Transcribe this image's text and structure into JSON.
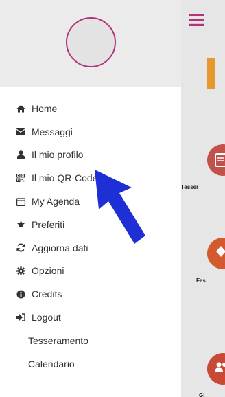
{
  "menu": {
    "items": [
      {
        "label": "Home",
        "icon": "home-icon"
      },
      {
        "label": "Messaggi",
        "icon": "envelope-icon"
      },
      {
        "label": "Il mio profilo",
        "icon": "user-icon"
      },
      {
        "label": "Il mio QR-Code",
        "icon": "qrcode-icon"
      },
      {
        "label": "My Agenda",
        "icon": "calendar-icon"
      },
      {
        "label": "Preferiti",
        "icon": "star-icon"
      },
      {
        "label": "Aggiorna dati",
        "icon": "refresh-icon"
      },
      {
        "label": "Opzioni",
        "icon": "gear-icon"
      },
      {
        "label": "Credits",
        "icon": "info-icon"
      },
      {
        "label": "Logout",
        "icon": "logout-icon"
      },
      {
        "label": "Tesseramento",
        "icon": ""
      },
      {
        "label": "Calendario",
        "icon": ""
      }
    ]
  },
  "background": {
    "tiles": [
      {
        "label": "Tesser"
      },
      {
        "label": "Fes"
      },
      {
        "label": "Gi"
      }
    ]
  },
  "colors": {
    "accent": "#b3337a",
    "orange": "#e4982d",
    "arrow": "#1f2fd6",
    "header_bg": "#ebebeb"
  }
}
